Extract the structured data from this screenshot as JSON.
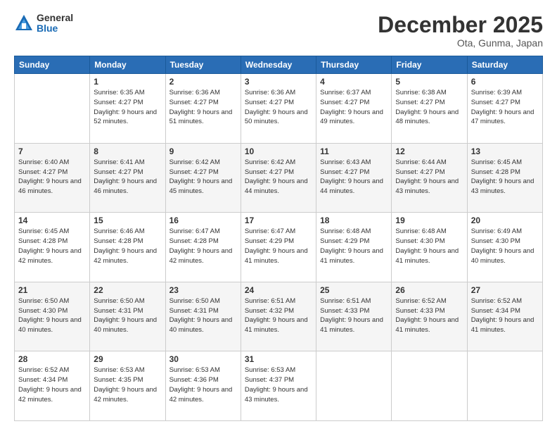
{
  "logo": {
    "general": "General",
    "blue": "Blue"
  },
  "title": "December 2025",
  "location": "Ota, Gunma, Japan",
  "weekdays": [
    "Sunday",
    "Monday",
    "Tuesday",
    "Wednesday",
    "Thursday",
    "Friday",
    "Saturday"
  ],
  "weeks": [
    [
      {
        "day": "",
        "info": ""
      },
      {
        "day": "1",
        "info": "Sunrise: 6:35 AM\nSunset: 4:27 PM\nDaylight: 9 hours\nand 52 minutes."
      },
      {
        "day": "2",
        "info": "Sunrise: 6:36 AM\nSunset: 4:27 PM\nDaylight: 9 hours\nand 51 minutes."
      },
      {
        "day": "3",
        "info": "Sunrise: 6:36 AM\nSunset: 4:27 PM\nDaylight: 9 hours\nand 50 minutes."
      },
      {
        "day": "4",
        "info": "Sunrise: 6:37 AM\nSunset: 4:27 PM\nDaylight: 9 hours\nand 49 minutes."
      },
      {
        "day": "5",
        "info": "Sunrise: 6:38 AM\nSunset: 4:27 PM\nDaylight: 9 hours\nand 48 minutes."
      },
      {
        "day": "6",
        "info": "Sunrise: 6:39 AM\nSunset: 4:27 PM\nDaylight: 9 hours\nand 47 minutes."
      }
    ],
    [
      {
        "day": "7",
        "info": "Sunrise: 6:40 AM\nSunset: 4:27 PM\nDaylight: 9 hours\nand 46 minutes."
      },
      {
        "day": "8",
        "info": "Sunrise: 6:41 AM\nSunset: 4:27 PM\nDaylight: 9 hours\nand 46 minutes."
      },
      {
        "day": "9",
        "info": "Sunrise: 6:42 AM\nSunset: 4:27 PM\nDaylight: 9 hours\nand 45 minutes."
      },
      {
        "day": "10",
        "info": "Sunrise: 6:42 AM\nSunset: 4:27 PM\nDaylight: 9 hours\nand 44 minutes."
      },
      {
        "day": "11",
        "info": "Sunrise: 6:43 AM\nSunset: 4:27 PM\nDaylight: 9 hours\nand 44 minutes."
      },
      {
        "day": "12",
        "info": "Sunrise: 6:44 AM\nSunset: 4:27 PM\nDaylight: 9 hours\nand 43 minutes."
      },
      {
        "day": "13",
        "info": "Sunrise: 6:45 AM\nSunset: 4:28 PM\nDaylight: 9 hours\nand 43 minutes."
      }
    ],
    [
      {
        "day": "14",
        "info": "Sunrise: 6:45 AM\nSunset: 4:28 PM\nDaylight: 9 hours\nand 42 minutes."
      },
      {
        "day": "15",
        "info": "Sunrise: 6:46 AM\nSunset: 4:28 PM\nDaylight: 9 hours\nand 42 minutes."
      },
      {
        "day": "16",
        "info": "Sunrise: 6:47 AM\nSunset: 4:28 PM\nDaylight: 9 hours\nand 42 minutes."
      },
      {
        "day": "17",
        "info": "Sunrise: 6:47 AM\nSunset: 4:29 PM\nDaylight: 9 hours\nand 41 minutes."
      },
      {
        "day": "18",
        "info": "Sunrise: 6:48 AM\nSunset: 4:29 PM\nDaylight: 9 hours\nand 41 minutes."
      },
      {
        "day": "19",
        "info": "Sunrise: 6:48 AM\nSunset: 4:30 PM\nDaylight: 9 hours\nand 41 minutes."
      },
      {
        "day": "20",
        "info": "Sunrise: 6:49 AM\nSunset: 4:30 PM\nDaylight: 9 hours\nand 40 minutes."
      }
    ],
    [
      {
        "day": "21",
        "info": "Sunrise: 6:50 AM\nSunset: 4:30 PM\nDaylight: 9 hours\nand 40 minutes."
      },
      {
        "day": "22",
        "info": "Sunrise: 6:50 AM\nSunset: 4:31 PM\nDaylight: 9 hours\nand 40 minutes."
      },
      {
        "day": "23",
        "info": "Sunrise: 6:50 AM\nSunset: 4:31 PM\nDaylight: 9 hours\nand 40 minutes."
      },
      {
        "day": "24",
        "info": "Sunrise: 6:51 AM\nSunset: 4:32 PM\nDaylight: 9 hours\nand 41 minutes."
      },
      {
        "day": "25",
        "info": "Sunrise: 6:51 AM\nSunset: 4:33 PM\nDaylight: 9 hours\nand 41 minutes."
      },
      {
        "day": "26",
        "info": "Sunrise: 6:52 AM\nSunset: 4:33 PM\nDaylight: 9 hours\nand 41 minutes."
      },
      {
        "day": "27",
        "info": "Sunrise: 6:52 AM\nSunset: 4:34 PM\nDaylight: 9 hours\nand 41 minutes."
      }
    ],
    [
      {
        "day": "28",
        "info": "Sunrise: 6:52 AM\nSunset: 4:34 PM\nDaylight: 9 hours\nand 42 minutes."
      },
      {
        "day": "29",
        "info": "Sunrise: 6:53 AM\nSunset: 4:35 PM\nDaylight: 9 hours\nand 42 minutes."
      },
      {
        "day": "30",
        "info": "Sunrise: 6:53 AM\nSunset: 4:36 PM\nDaylight: 9 hours\nand 42 minutes."
      },
      {
        "day": "31",
        "info": "Sunrise: 6:53 AM\nSunset: 4:37 PM\nDaylight: 9 hours\nand 43 minutes."
      },
      {
        "day": "",
        "info": ""
      },
      {
        "day": "",
        "info": ""
      },
      {
        "day": "",
        "info": ""
      }
    ]
  ]
}
